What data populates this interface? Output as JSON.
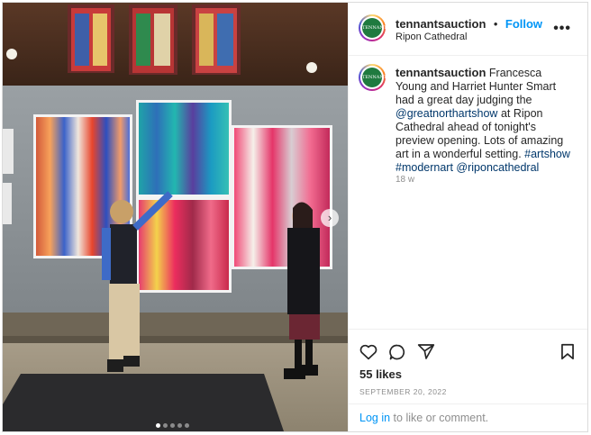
{
  "post": {
    "username": "tennantsauction",
    "separator": "•",
    "follow_label": "Follow",
    "location": "Ripon Cathedral",
    "more_icon": "more-horizontal-icon",
    "avatar_text": "TENNANTS"
  },
  "caption": {
    "username": "tennantsauction",
    "text_1": "Francesca Young and Harriet Hunter Smart had a great day judging the",
    "mention_1": "@greatnorthartshow",
    "text_2": "at Ripon Cathedral ahead of tonight's preview opening. Lots of amazing art in a wonderful setting.",
    "hashtag_1": "#artshow",
    "hashtag_2": "#modernart",
    "mention_2": "@riponcathedral",
    "time_ago": "18 w"
  },
  "actions": {
    "like_icon": "heart-icon",
    "comment_icon": "comment-icon",
    "share_icon": "send-icon",
    "save_icon": "bookmark-icon"
  },
  "likes": "55 likes",
  "date": "SEPTEMBER 20, 2022",
  "login": {
    "link": "Log in",
    "text": "to like or comment."
  },
  "carousel": {
    "next_icon": "chevron-right-icon",
    "total_slides": 5,
    "active_index": 0
  },
  "colors": {
    "accent": "#0095f6",
    "link": "#00376b",
    "muted": "#8e8e8e",
    "border": "#dbdbdb"
  }
}
